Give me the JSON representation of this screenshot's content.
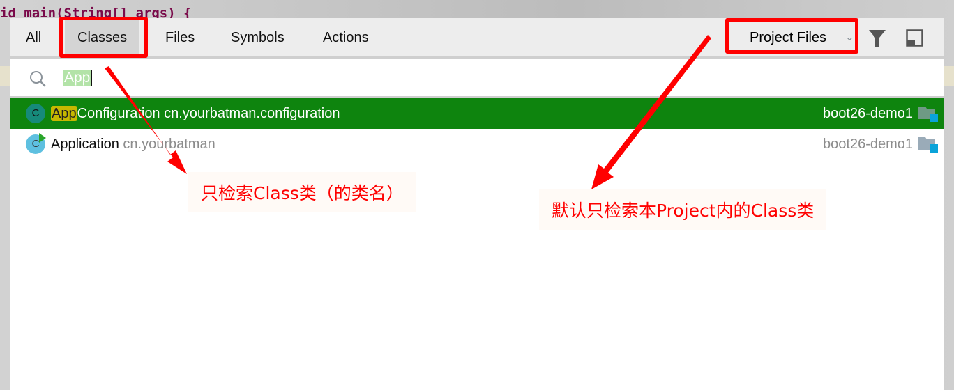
{
  "editor": {
    "code_line": "id main(String[] args) {"
  },
  "tabs": [
    {
      "label": "All"
    },
    {
      "label": "Classes",
      "active": true
    },
    {
      "label": "Files"
    },
    {
      "label": "Symbols"
    },
    {
      "label": "Actions"
    }
  ],
  "scope": {
    "selected": "Project Files"
  },
  "toolbar_icons": [
    "filter-icon",
    "open-in-window-icon"
  ],
  "search": {
    "query": "App"
  },
  "results": [
    {
      "match": "App",
      "rest": "Configuration",
      "package": "cn.yourbatman.configuration",
      "module": "boot26-demo1",
      "selected": true,
      "icon": "C"
    },
    {
      "match": "",
      "rest": "Application",
      "package": "cn.yourbatman",
      "module": "boot26-demo1",
      "selected": false,
      "icon": "C"
    }
  ],
  "annotations": {
    "classes_note": "只检索Class类（的类名）",
    "scope_note": "默认只检索本Project内的Class类"
  },
  "colors": {
    "selected_row": "#0e840e",
    "annotation": "#ff0000",
    "match_highlight": "#c6b800"
  }
}
